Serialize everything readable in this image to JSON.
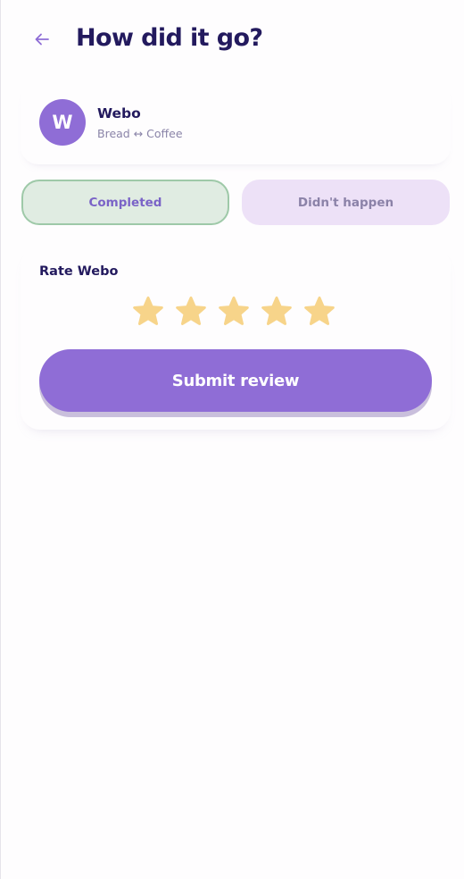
{
  "header": {
    "title": "How did it go?",
    "back_icon": "arrow-left-icon"
  },
  "partner": {
    "initial": "W",
    "name": "Webo",
    "trade": "Bread ↔ Coffee"
  },
  "outcome": {
    "completed_label": "Completed",
    "didnt_happen_label": "Didn't happen",
    "selected": "Completed"
  },
  "rating": {
    "label": "Rate Webo",
    "stars_total": 5,
    "star_color": "#f7d48a"
  },
  "submit": {
    "label": "Submit review"
  },
  "colors": {
    "accent": "#8f6dd6",
    "title": "#231a5e",
    "completed_bg": "#e0ece2",
    "completed_border": "#9ec9a8",
    "didnt_bg": "#ede1f7"
  }
}
